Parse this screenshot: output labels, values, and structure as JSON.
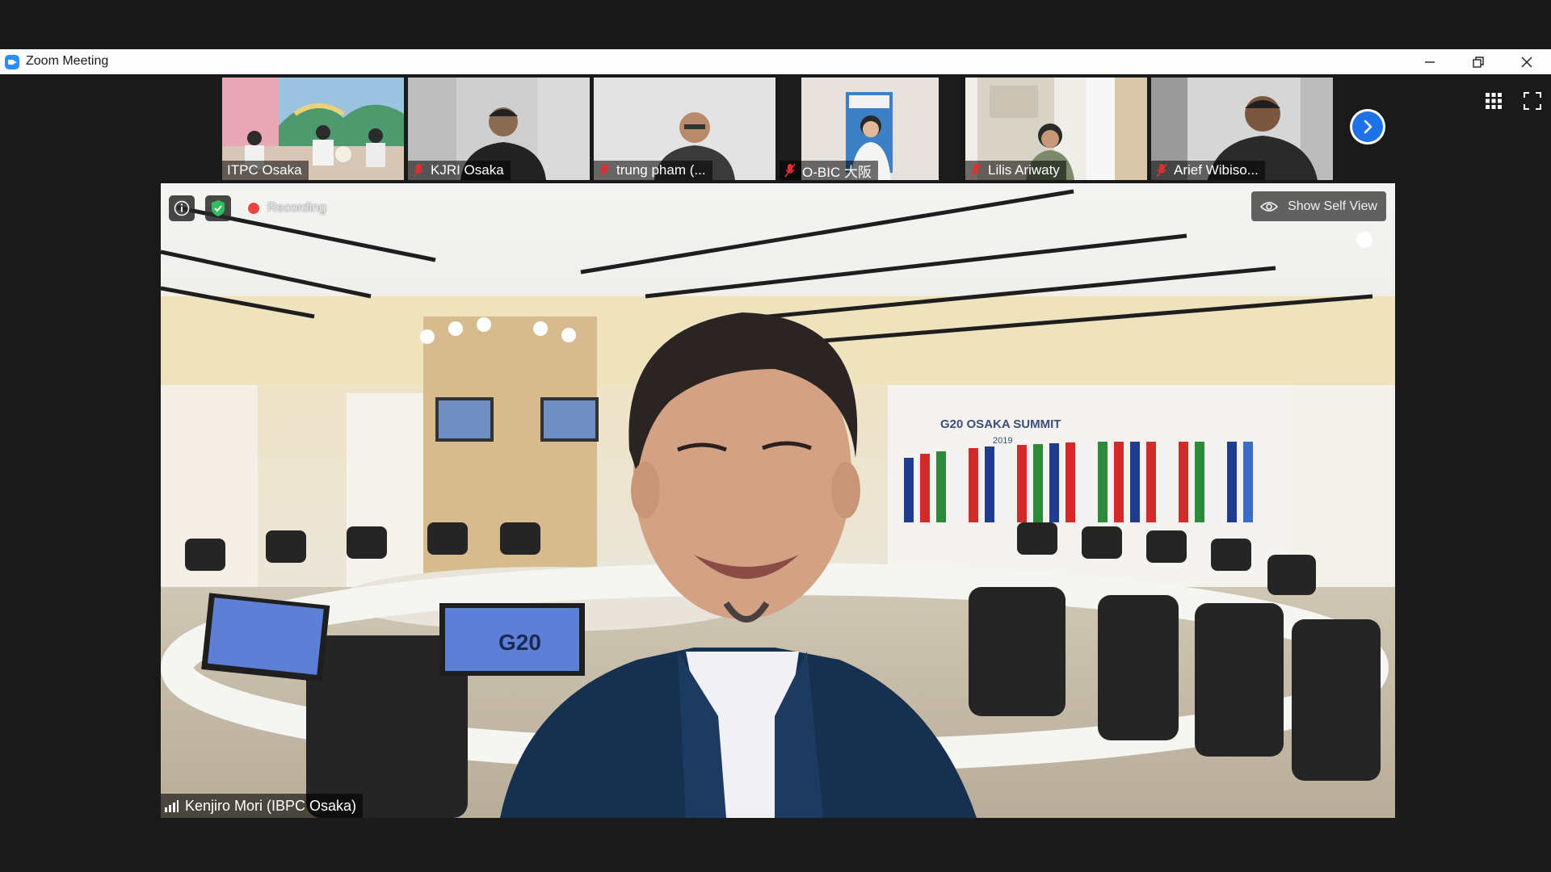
{
  "window": {
    "title": "Zoom Meeting"
  },
  "gallery": [
    {
      "name": "ITPC Osaka",
      "muted": false
    },
    {
      "name": "KJRI Osaka",
      "muted": true
    },
    {
      "name": "trung pham (...",
      "muted": true
    },
    {
      "name": "O-BIC 大阪",
      "muted": true
    },
    {
      "name": "Lilis Ariwaty",
      "muted": true
    },
    {
      "name": "Arief Wibiso...",
      "muted": true
    }
  ],
  "speaker": {
    "name": "Kenjiro Mori (IBPC Osaka)",
    "recording_label": "Recording",
    "show_self_view_label": "Show Self View",
    "backdrop_sign": "G20 OSAKA SUMMIT",
    "backdrop_year": "2019",
    "screen_text": "G20"
  },
  "colors": {
    "accent": "#1e71e6",
    "recording": "#e8453c",
    "secure": "#2fbf5f",
    "background": "#1a1a1a"
  },
  "icons": [
    "zoom-app-icon",
    "minimize-icon",
    "restore-icon",
    "close-icon",
    "grid-view-icon",
    "fullscreen-icon",
    "chevron-right-icon",
    "mic-off-icon",
    "info-icon",
    "shield-check-icon",
    "eye-icon",
    "signal-icon"
  ]
}
